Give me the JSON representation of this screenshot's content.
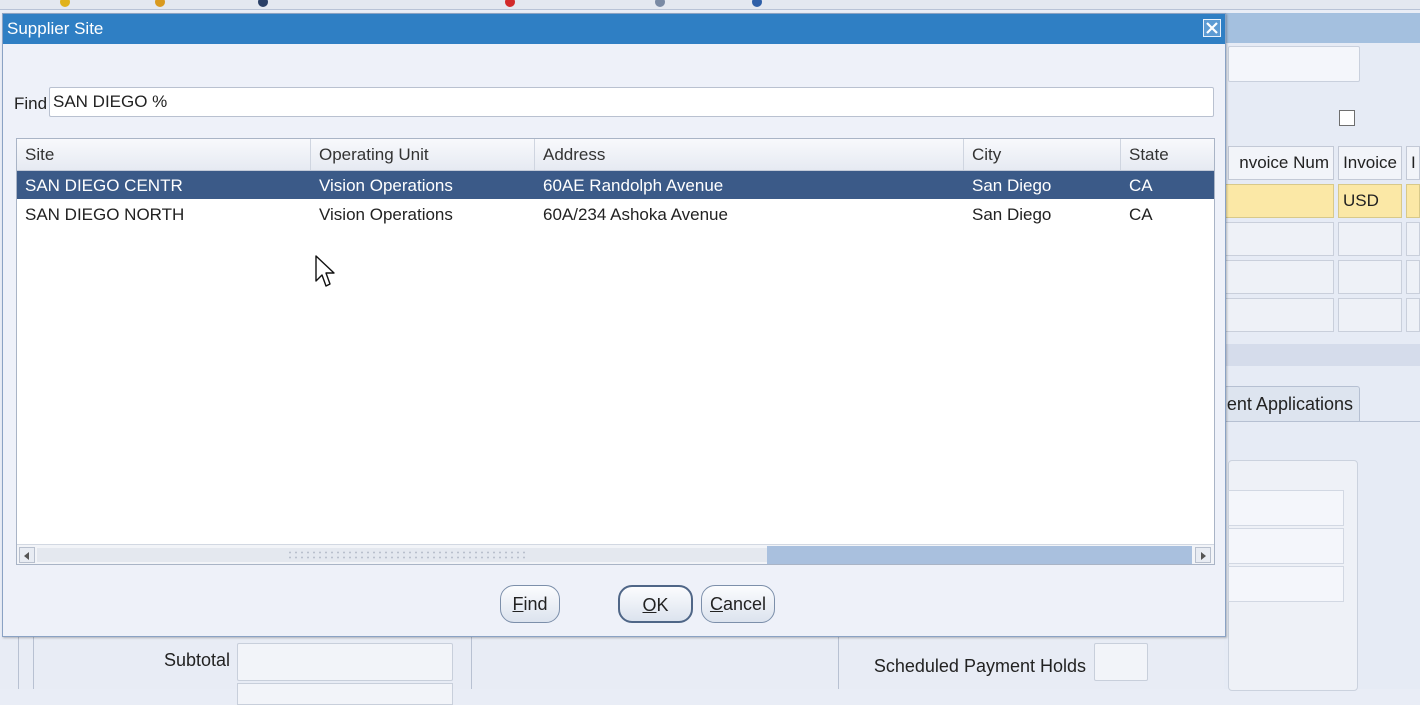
{
  "dialog": {
    "title": "Supplier Site",
    "find_label": "Find",
    "find_value": "SAN DIEGO %",
    "columns": [
      "Site",
      "Operating Unit",
      "Address",
      "City",
      "State"
    ],
    "rows": [
      {
        "site": "SAN DIEGO CENTR",
        "operating_unit": "Vision Operations",
        "address": "60AE Randolph Avenue",
        "city": "San Diego",
        "state": "CA",
        "selected": true
      },
      {
        "site": "SAN DIEGO NORTH",
        "operating_unit": "Vision Operations",
        "address": "60A/234 Ashoka Avenue",
        "city": "San Diego",
        "state": "CA",
        "selected": false
      }
    ],
    "buttons": {
      "find": {
        "mnemonic": "F",
        "rest": "ind"
      },
      "ok": {
        "mnemonic": "O",
        "rest": "K"
      },
      "cancel": {
        "mnemonic": "C",
        "rest": "ancel"
      }
    }
  },
  "background": {
    "col_invoice_num": "nvoice Num",
    "col_invoice": "Invoice",
    "col_next": "I",
    "currency_value": "USD",
    "tab_label": "ent Applications",
    "subtotal_label": "Subtotal",
    "scheduled_payment_holds_label": "Scheduled Payment Holds"
  },
  "colors": {
    "title_bar": "#2f7fc4",
    "selected_row": "#3b5a88",
    "highlight_field": "#fbe8a6"
  }
}
